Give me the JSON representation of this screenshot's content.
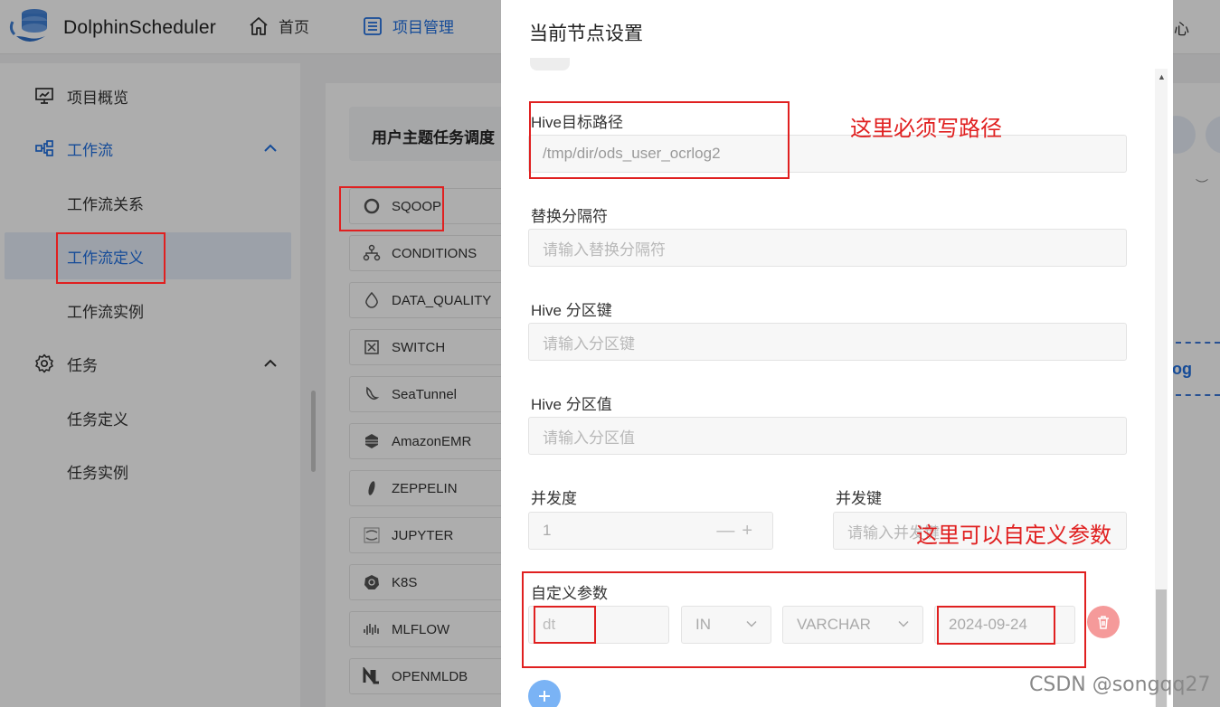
{
  "header": {
    "brand": "DolphinScheduler",
    "nav": [
      {
        "label": "首页",
        "icon": "home-icon"
      },
      {
        "label": "项目管理",
        "icon": "list-icon"
      }
    ],
    "right_partial": "心"
  },
  "sidebar": {
    "items": [
      {
        "label": "项目概览",
        "icon": "presentation-icon"
      },
      {
        "label": "工作流",
        "icon": "workflow-icon"
      },
      {
        "label": "工作流关系"
      },
      {
        "label": "工作流定义"
      },
      {
        "label": "工作流实例"
      },
      {
        "label": "任务",
        "icon": "gear-icon"
      },
      {
        "label": "任务定义"
      },
      {
        "label": "任务实例"
      }
    ]
  },
  "main": {
    "workflow_title": "用户主题任务调度",
    "tools": [
      "SQOOP",
      "CONDITIONS",
      "DATA_QUALITY",
      "SWITCH",
      "SeaTunnel",
      "AmazonEMR",
      "ZEPPELIN",
      "JUPYTER",
      "K8S",
      "MLFLOW",
      "OPENMLDB"
    ],
    "right_partial_text": "og"
  },
  "drawer": {
    "title": "当前节点设置",
    "hive_path": {
      "label": "Hive目标路径",
      "value": "/tmp/dir/ods_user_ocrlog2"
    },
    "replace_delim": {
      "label": "替换分隔符",
      "placeholder": "请输入替换分隔符"
    },
    "partition_key": {
      "label": "Hive 分区键",
      "placeholder": "请输入分区键"
    },
    "partition_value": {
      "label": "Hive 分区值",
      "placeholder": "请输入分区值"
    },
    "concurrency": {
      "label": "并发度",
      "value": "1",
      "minus": "—",
      "plus": "+"
    },
    "concurrency_key": {
      "label": "并发键",
      "placeholder": "请输入并发键"
    },
    "custom_params": {
      "label": "自定义参数",
      "prop": "dt",
      "direct": "IN",
      "type": "VARCHAR",
      "value": "2024-09-24"
    }
  },
  "annotations": {
    "path_note": "这里必须写路径",
    "param_note": "这里可以自定义参数"
  },
  "watermark": "CSDN @songqq27"
}
